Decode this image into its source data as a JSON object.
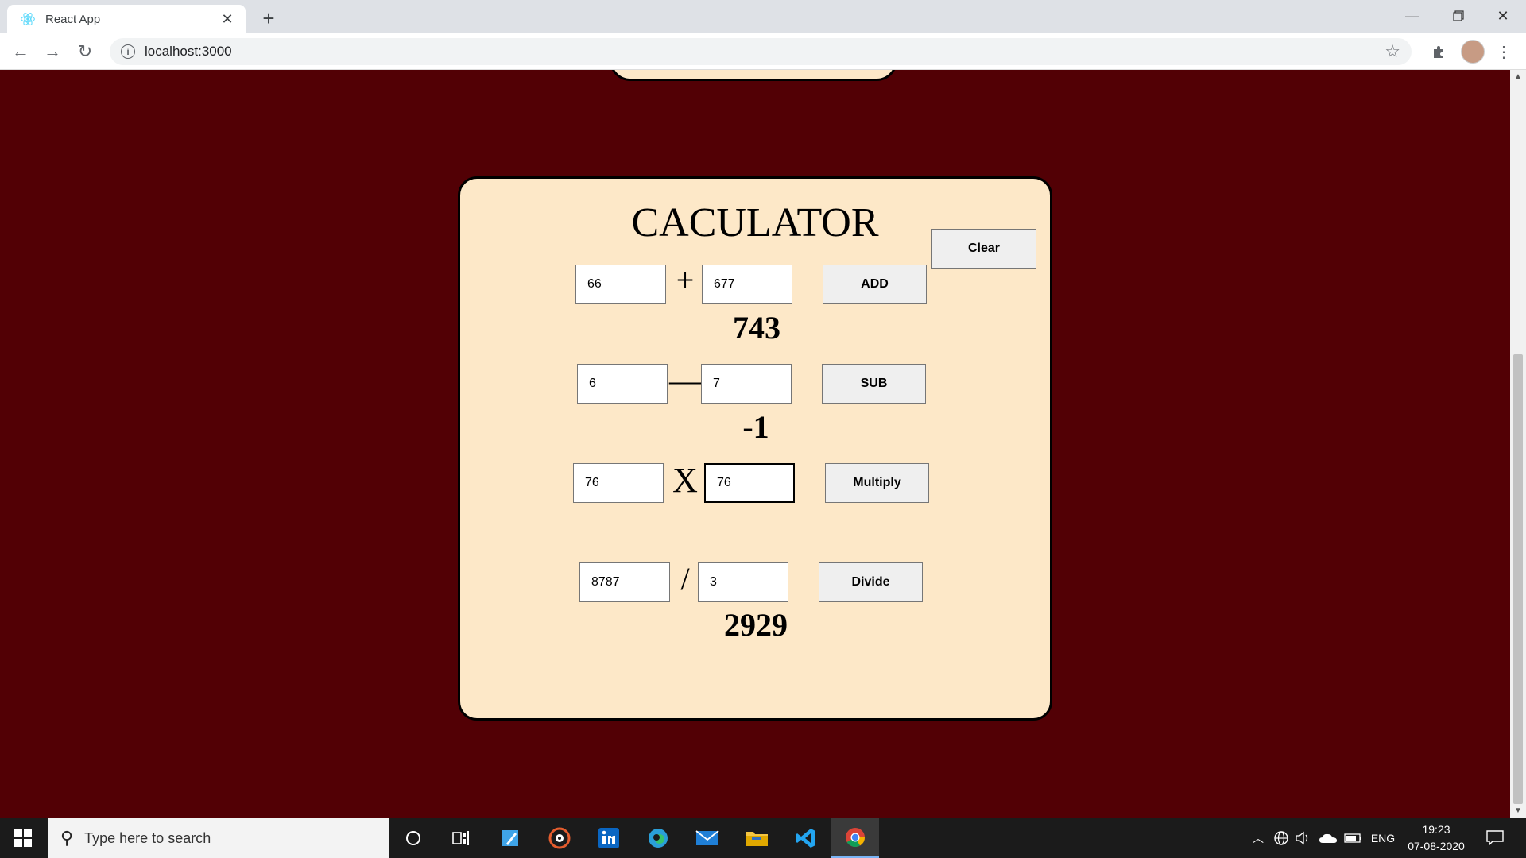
{
  "browser": {
    "tab_title": "React App",
    "url": "localhost:3000"
  },
  "calculator": {
    "title": "CACULATOR",
    "clear_label": "Clear",
    "add": {
      "a": "66",
      "b": "677",
      "symbol": "+",
      "button": "ADD",
      "result": "743"
    },
    "sub": {
      "a": "6",
      "b": "7",
      "symbol": "—",
      "button": "SUB",
      "result": "-1"
    },
    "mul": {
      "a": "76",
      "b": "76",
      "symbol": "X",
      "button": "Multiply",
      "result": ""
    },
    "div": {
      "a": "8787",
      "b": "3",
      "symbol": "/",
      "button": "Divide",
      "result": "2929"
    }
  },
  "taskbar": {
    "search_placeholder": "Type here to search",
    "language": "ENG",
    "time": "19:23",
    "date": "07-08-2020"
  },
  "icons": [
    "react-icon",
    "close-icon",
    "new-tab-icon",
    "minimize-icon",
    "restore-icon",
    "window-close-icon",
    "back-icon",
    "forward-icon",
    "reload-icon",
    "info-icon",
    "bookmark-star-icon",
    "extensions-icon",
    "profile-avatar",
    "menu-dots-icon",
    "windows-start-icon",
    "search-icon",
    "cortana-icon",
    "task-view-icon",
    "notepad-icon",
    "media-player-icon",
    "linkedin-icon",
    "edge-icon",
    "mail-icon",
    "file-explorer-icon",
    "vscode-icon",
    "chrome-icon",
    "tray-chevron-icon",
    "network-icon",
    "volume-icon",
    "onedrive-icon",
    "battery-icon",
    "notifications-icon"
  ]
}
